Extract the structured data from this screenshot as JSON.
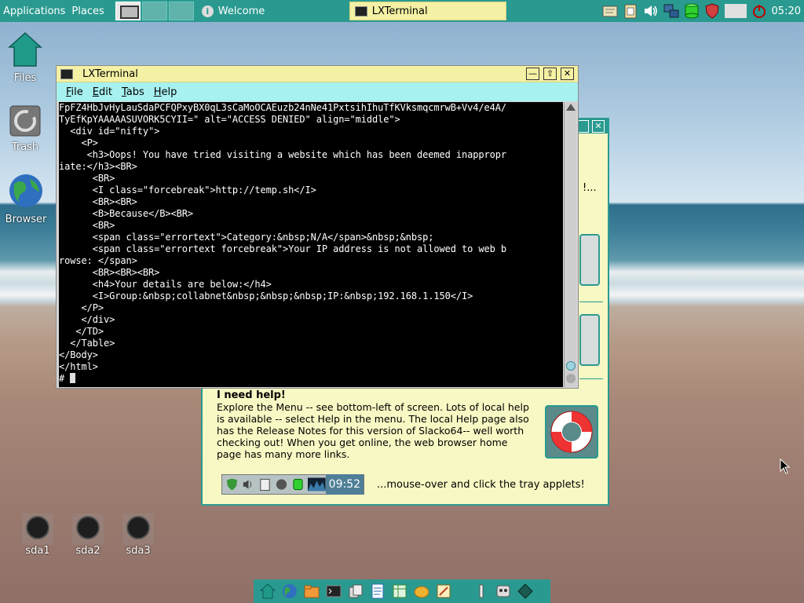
{
  "top_panel": {
    "menu_applications": "Applications",
    "menu_places": "Places",
    "task_welcome": "Welcome",
    "task_terminal": "LXTerminal",
    "clock": "05:20"
  },
  "desktop": {
    "icons": [
      {
        "label": "Files"
      },
      {
        "label": "Trash"
      },
      {
        "label": "Browser"
      }
    ],
    "drives": [
      {
        "label": "sda1"
      },
      {
        "label": "sda2"
      },
      {
        "label": "sda3"
      }
    ]
  },
  "welcome": {
    "truncated_text": "!...",
    "help_title": "I need help!",
    "help_body": "Explore the Menu -- see bottom-left of screen. Lots of local help is available -- select Help in the menu. The local Help page also has the Release Notes for this version of Slacko64-- well worth checking out! When you get online, the web browser home page has many more links.",
    "tray_clock": "09:52",
    "tray_hint": "...mouse-over and click the tray applets!"
  },
  "terminal": {
    "title": "LXTerminal",
    "menu": [
      "File",
      "Edit",
      "Tabs",
      "Help"
    ],
    "lines": [
      "FpFZ4HbJvHyLauSdaPCFQPxyBX0qL3sCaMoOCAEuzb24nNe41PxtsihIhuTfKVksmqcmrwB+Vv4/e4A/",
      "TyEfKpYAAAAASUVORK5CYII=\" alt=\"ACCESS DENIED\" align=\"middle\">",
      "  <div id=\"nifty\">",
      "    <P>",
      "     <h3>Oops! You have tried visiting a website which has been deemed inappropr",
      "iate:</h3><BR>",
      "      <BR>",
      "      <I class=\"forcebreak\">http://temp.sh</I>",
      "      <BR><BR>",
      "      <B>Because</B><BR>",
      "      <BR>",
      "      <span class=\"errortext\">Category:&nbsp;N/A</span>&nbsp;&nbsp;",
      "      <span class=\"errortext forcebreak\">Your IP address is not allowed to web b",
      "rowse: </span>",
      "      <BR><BR><BR>",
      "      <h4>Your details are below:</h4>",
      "      <I>Group:&nbsp;collabnet&nbsp;&nbsp;&nbsp;IP:&nbsp;192.168.1.150</I>",
      "    </P>",
      "    </div>",
      "   </TD>",
      "  </Table>",
      "</Body>",
      "</html>"
    ],
    "prompt": "# "
  },
  "colors": {
    "panel": "#2a9a90",
    "titlebar": "#f4f1a4",
    "menubar": "#a7f1f1",
    "welcome_bg": "#f8f8c4"
  }
}
